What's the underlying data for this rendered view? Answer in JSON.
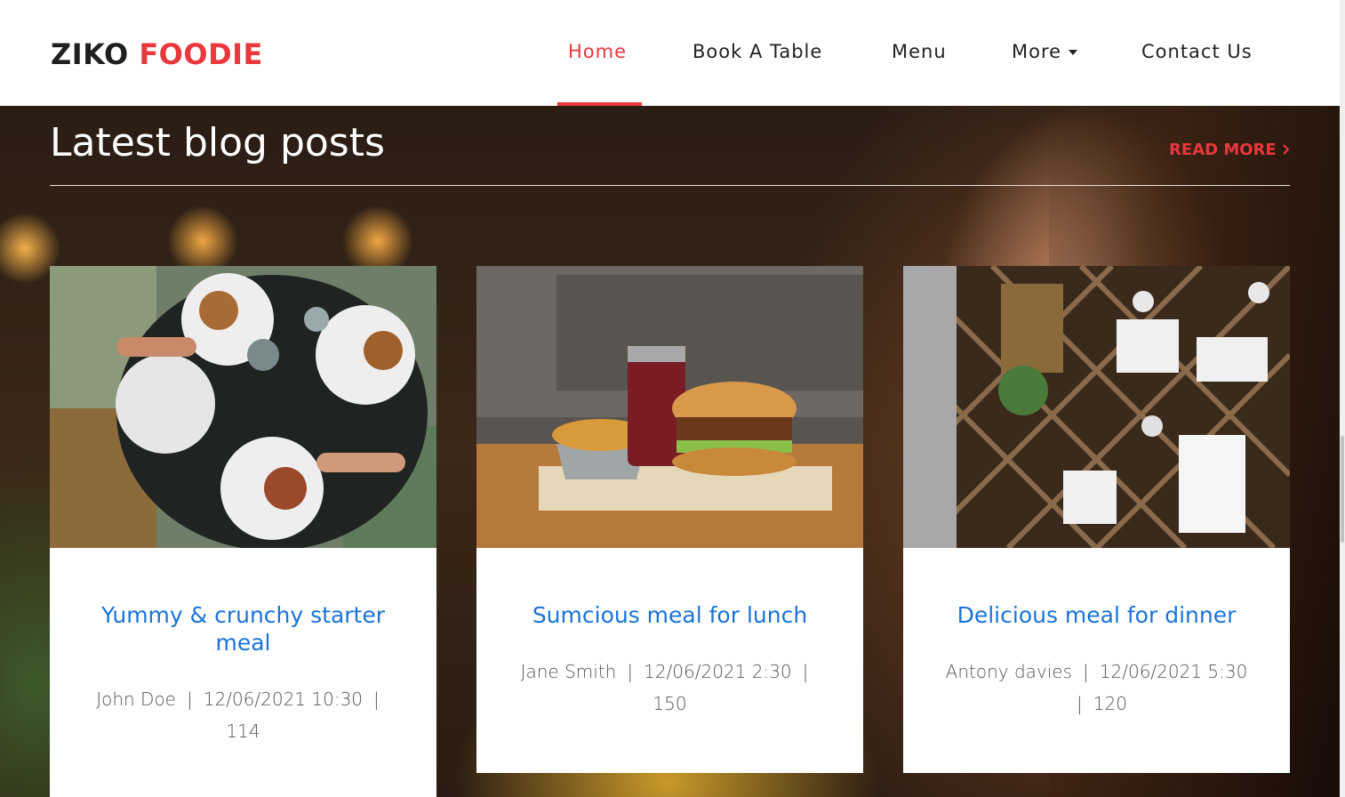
{
  "brand": {
    "first": "ZIKO",
    "second": "FOODIE"
  },
  "nav": {
    "items": [
      {
        "label": "Home",
        "active": true
      },
      {
        "label": "Book A Table"
      },
      {
        "label": "Menu"
      },
      {
        "label": "More",
        "dropdown": true
      },
      {
        "label": "Contact Us"
      }
    ]
  },
  "section": {
    "title": "Latest blog posts",
    "read_more": "READ MORE",
    "read_more_icon": "chevron-right-icon"
  },
  "posts": [
    {
      "title": "Yummy & crunchy starter meal",
      "author": "John Doe",
      "datetime": "12/06/2021 10:30",
      "count": "114",
      "image": "overhead table with burgers and fries"
    },
    {
      "title": "Sumcious meal for lunch",
      "author": "Jane Smith",
      "datetime": "12/06/2021 2:30",
      "count": "150",
      "image": "burger with fries and red drink"
    },
    {
      "title": "Delicious meal for dinner",
      "author": "Antony davies",
      "datetime": "12/06/2021 5:30",
      "count": "120",
      "image": "overhead restaurant dining room"
    }
  ],
  "colors": {
    "accent": "#e8383d",
    "link": "#1a73d9",
    "text": "#222222"
  }
}
